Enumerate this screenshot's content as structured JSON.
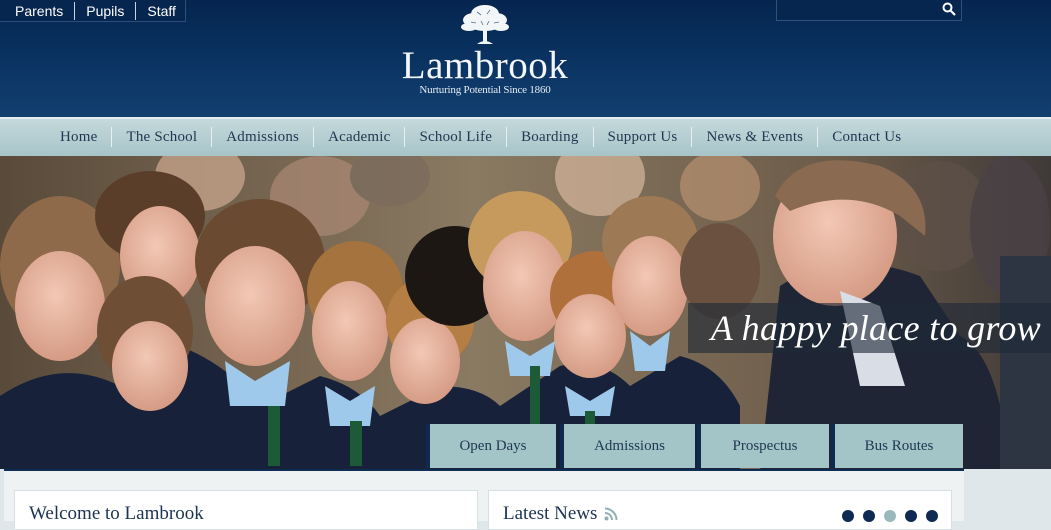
{
  "header": {
    "top_links": [
      "Parents",
      "Pupils",
      "Staff"
    ],
    "search": {
      "placeholder": "",
      "icon": "search-icon"
    },
    "logo": {
      "name": "Lambrook",
      "tagline": "Nurturing Potential Since 1860",
      "icon": "tree-icon"
    }
  },
  "nav": {
    "items": [
      "Home",
      "The School",
      "Admissions",
      "Academic",
      "School Life",
      "Boarding",
      "Support Us",
      "News & Events",
      "Contact Us"
    ]
  },
  "hero": {
    "image": "pupils-greeting-visitor-photo",
    "tagline": "A happy place to grow"
  },
  "quick_links": [
    "Open Days",
    "Admissions",
    "Prospectus",
    "Bus Routes"
  ],
  "content": {
    "welcome_title": "Welcome to Lambrook",
    "news_title": "Latest News",
    "news_icon": "rss-icon",
    "carousel": {
      "count": 5,
      "active": 3
    }
  },
  "colors": {
    "navy": "#0b3564",
    "teal": "#a7c4c8",
    "text": "#1f3650"
  }
}
